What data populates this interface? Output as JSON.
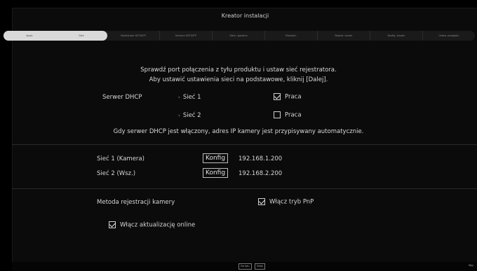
{
  "window": {
    "title": "Kreator instalacji"
  },
  "steps": [
    {
      "label": "Język",
      "done": true
    },
    {
      "label": "Sieć",
      "done": true
    },
    {
      "label": "Rejestrator DST/NTP",
      "done": false
    },
    {
      "label": "Kamera DST/NTP",
      "done": false
    },
    {
      "label": "Data i godzina",
      "done": false
    },
    {
      "label": "Rozdziel.",
      "done": false
    },
    {
      "label": "Rejestr. kamer",
      "done": false
    },
    {
      "label": "Konfig. kanału",
      "done": false
    },
    {
      "label": "Ustaw. podglądu",
      "done": false
    }
  ],
  "intro": {
    "line1": "Sprawdź port połączenia z tyłu produktu i ustaw sieć rejestratora.",
    "line2": "Aby ustawić ustawienia sieci na podstawowe, kliknij [Dalej]."
  },
  "dhcp": {
    "label": "Serwer DHCP",
    "net1_label": "Sieć 1",
    "net1_option": "Praca",
    "net1_checked": true,
    "net2_label": "Sieć 2",
    "net2_option": "Praca",
    "net2_checked": false,
    "note": "Gdy serwer DHCP jest włączony, adres IP kamery jest przypisywany automatycznie."
  },
  "networks": [
    {
      "label": "Sieć 1 (Kamera)",
      "button": "Konfig",
      "ip": "192.168.1.200"
    },
    {
      "label": "Sieć 2 (Wsz.)",
      "button": "Konfig",
      "ip": "192.168.2.200"
    }
  ],
  "registration": {
    "label": "Metoda rejestracji kamery",
    "option": "Włącz tryb PnP",
    "checked": true
  },
  "online_update": {
    "label": "Włącz aktualizację online",
    "checked": true
  },
  "footer": {
    "back": "Do tyłu",
    "next": "Dalej",
    "skip": "Wyj."
  }
}
